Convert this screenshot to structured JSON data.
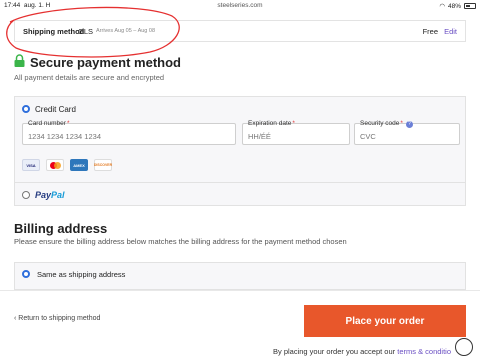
{
  "status_bar": {
    "time": "17:44",
    "date": "aug. 1. H",
    "url": "steelseries.com",
    "battery": "48%"
  },
  "shipping": {
    "label": "Shipping method",
    "carrier": "GLS",
    "arrives": "Arrives Aug 05 – Aug 08",
    "price": "Free",
    "edit": "Edit"
  },
  "payment": {
    "title": "Secure payment method",
    "subtitle": "All payment details are secure and encrypted",
    "credit_card_label": "Credit Card",
    "card_number": {
      "label": "Card number",
      "placeholder": "1234 1234 1234 1234"
    },
    "expiration": {
      "label": "Expiration date",
      "placeholder": "HH/ÉÉ"
    },
    "security": {
      "label": "Security code",
      "placeholder": "CVC"
    },
    "card_logos": [
      "VISA",
      "Mastercard",
      "AMEX",
      "DISCOVER"
    ],
    "paypal": {
      "part1": "Pay",
      "part2": "Pal"
    }
  },
  "billing": {
    "title": "Billing address",
    "subtitle": "Please ensure the billing address below matches the billing address for the payment method chosen",
    "option": "Same as shipping address"
  },
  "footer": {
    "back": "‹ Return to shipping method",
    "order_button": "Place your order",
    "legal_prefix": "By placing your order you accept our",
    "legal_link": "terms & conditio"
  },
  "colors": {
    "accent": "#e8572b",
    "link": "#6a4fc3",
    "radio": "#2f6fdc",
    "annotation": "#e53030"
  }
}
